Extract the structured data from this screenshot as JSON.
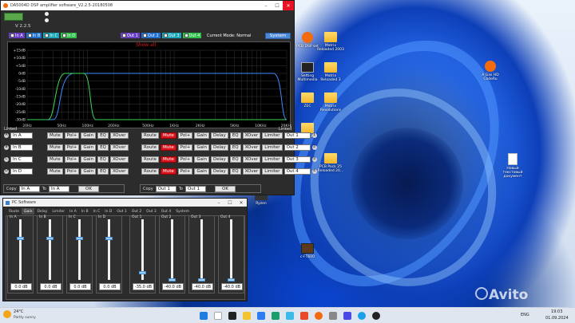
{
  "dsp": {
    "title": "DA5004D DSP amplifier software_V2.2.5-20180508",
    "version": "V 2.2.5",
    "channel_checks": [
      "In A",
      "In B",
      "In C",
      "In D"
    ],
    "out_checks": [
      "Out 1",
      "Out 2",
      "Out 3",
      "Out 4"
    ],
    "current_mode": "Current Mode:  Normal",
    "system_btn": "System",
    "show_all": "Show all",
    "y_ticks": [
      "+15dB",
      "+10dB",
      "+5dB",
      "0dB",
      "-5dB",
      "-10dB",
      "-15dB",
      "-20dB",
      "-25dB",
      "-30dB"
    ],
    "x_ticks": [
      "20Hz",
      "50Hz",
      "100Hz",
      "200Hz",
      "500Hz",
      "1KHz",
      "2KHz",
      "5KHz",
      "10KHz",
      "20KHz"
    ],
    "linked_left": "Linked",
    "linked_right": "Linked",
    "inputs": [
      {
        "letter": "A",
        "name": "In A"
      },
      {
        "letter": "B",
        "name": "In B"
      },
      {
        "letter": "C",
        "name": "In C"
      },
      {
        "letter": "D",
        "name": "In D"
      }
    ],
    "in_buttons": [
      "Mute",
      "Pol+",
      "Gain",
      "EQ",
      "XOver"
    ],
    "out_buttons": [
      "Route",
      "Mute",
      "Pol+",
      "Gain",
      "Delay",
      "EQ",
      "XOver",
      "Limiter"
    ],
    "outputs": [
      "Out 1",
      "Out 2",
      "Out 3",
      "Out 4"
    ],
    "out_nums": [
      "1",
      "2",
      "3",
      "4"
    ],
    "copy_label": "Copy",
    "to_label": "To",
    "copy_left_from": "In A",
    "copy_left_to": "In A",
    "copy_right_from": "Out 1",
    "copy_right_to": "Out 1",
    "ok": "OK"
  },
  "pc": {
    "title": "PC Software",
    "tabs": [
      "Route",
      "Gain",
      "Delay",
      "Limiter",
      "In A",
      "In B",
      "In C",
      "In D",
      "Out 1",
      "Out 2",
      "Out 3",
      "Out 4",
      "System"
    ],
    "active_tab": 1,
    "faders": [
      {
        "label": "In A",
        "value": "0.0 dB",
        "level": 0.7
      },
      {
        "label": "In B",
        "value": "0.0 dB",
        "level": 0.7
      },
      {
        "label": "In C",
        "value": "0.0 dB",
        "level": 0.7
      },
      {
        "label": "In D",
        "value": "0.0 dB",
        "level": 0.7
      },
      {
        "label": "Out 1",
        "value": "-35.0 dB",
        "level": 0.12
      },
      {
        "label": "Out 2",
        "value": "-40.0 dB",
        "level": 0.0
      },
      {
        "label": "Out 3",
        "value": "-40.0 dB",
        "level": 0.0
      },
      {
        "label": "Out 4",
        "value": "-40.0 dB",
        "level": 0.0
      }
    ]
  },
  "desktop_icons": [
    {
      "label": "PCB DSP set"
    },
    {
      "label": "Matrix Reloaded 2003"
    },
    {
      "label": "Setting Multimedia"
    },
    {
      "label": "Matrix Reloaded 3"
    },
    {
      "label": "ZEC"
    },
    {
      "label": "Matrix Revolutions"
    },
    {
      "label": "FROM DYN"
    },
    {
      "label": "PCB Pack 25 Reloaded 20..."
    },
    {
      "label": "Ryzen"
    },
    {
      "label": "A Gas HD CodeRu"
    },
    {
      "label": "Новый текстовый документ"
    },
    {
      "label": "c-FT600"
    }
  ],
  "taskbar": {
    "temp": "24°C",
    "weather": "Partly sunny",
    "lang": "ENG",
    "time": "19:03",
    "date": "01.09.2024",
    "watermark": "Avito"
  },
  "colors": {
    "graph_bg": "#000000",
    "curve_blue": "#3b8cff",
    "curve_green": "#3cd65a",
    "grid": "#3a3a3a",
    "accent_red": "#d9141e"
  }
}
